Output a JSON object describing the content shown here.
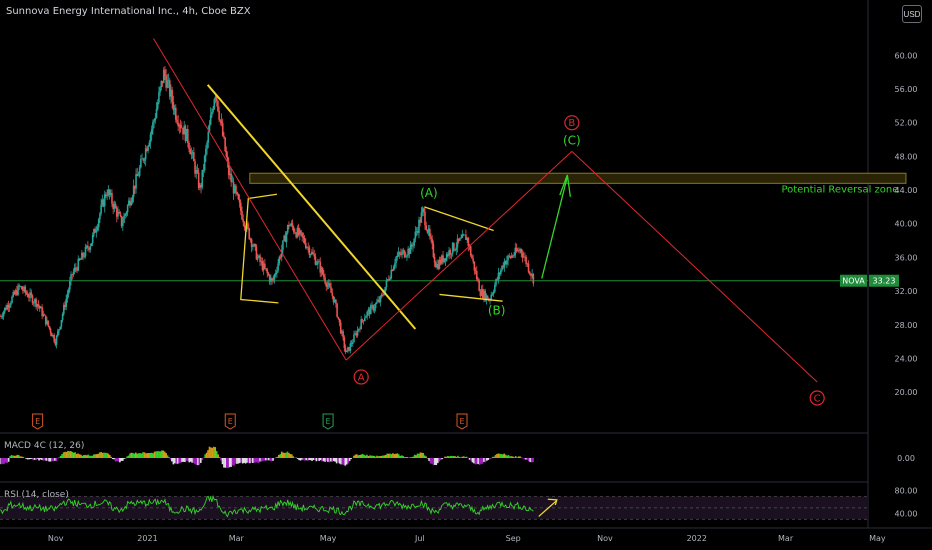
{
  "header": {
    "title": "Sunnova Energy International Inc., 4h, Cboe BZX"
  },
  "currency_button": "USD",
  "colors": {
    "bull": "#26a69a",
    "bear": "#ef5350",
    "yellow": "#f0d52a",
    "red": "#e0282d",
    "green": "#35d42a",
    "price_line": "#1e8c3a",
    "zone_fill": "#2a2306",
    "zone_border": "#8a7a20"
  },
  "chart_data": {
    "type": "candlestick",
    "title": "Sunnova Energy International Inc., 4h, Cboe BZX",
    "y_axis": {
      "ticks": [
        20.0,
        24.0,
        28.0,
        32.0,
        36.0,
        40.0,
        44.0,
        48.0,
        52.0,
        56.0,
        60.0
      ],
      "labels": [
        "20.00",
        "24.00",
        "28.00",
        "32.00",
        "36.00",
        "40.00",
        "44.00",
        "48.00",
        "52.00",
        "56.00",
        "60.00"
      ],
      "ylim": [
        15.5,
        64.2
      ]
    },
    "x_axis": {
      "labels": [
        "Nov",
        "2021",
        "Mar",
        "May",
        "Jul",
        "Sep",
        "Nov",
        "2022",
        "Mar",
        "May"
      ],
      "range": [
        "2020-09-25",
        "2022-05-28"
      ]
    },
    "last_price": {
      "ticker": "NOVA",
      "value": "33.23"
    },
    "price_path": [
      {
        "date": "2020-09-25",
        "price": 29.0
      },
      {
        "date": "2020-10-08",
        "price": 32.5
      },
      {
        "date": "2020-10-20",
        "price": 30.5
      },
      {
        "date": "2020-11-01",
        "price": 26.0
      },
      {
        "date": "2020-11-12",
        "price": 34.0
      },
      {
        "date": "2020-11-25",
        "price": 38.0
      },
      {
        "date": "2020-12-05",
        "price": 44.0
      },
      {
        "date": "2020-12-15",
        "price": 40.0
      },
      {
        "date": "2020-12-26",
        "price": 46.0
      },
      {
        "date": "2021-01-05",
        "price": 52.0
      },
      {
        "date": "2021-01-12",
        "price": 58.0
      },
      {
        "date": "2021-01-20",
        "price": 53.0
      },
      {
        "date": "2021-01-28",
        "price": 50.0
      },
      {
        "date": "2021-02-05",
        "price": 44.0
      },
      {
        "date": "2021-02-15",
        "price": 56.0
      },
      {
        "date": "2021-02-24",
        "price": 46.0
      },
      {
        "date": "2021-03-05",
        "price": 41.0
      },
      {
        "date": "2021-03-15",
        "price": 36.0
      },
      {
        "date": "2021-03-25",
        "price": 33.0
      },
      {
        "date": "2021-04-05",
        "price": 40.0
      },
      {
        "date": "2021-04-15",
        "price": 38.0
      },
      {
        "date": "2021-04-25",
        "price": 35.0
      },
      {
        "date": "2021-05-05",
        "price": 31.0
      },
      {
        "date": "2021-05-13",
        "price": 24.5
      },
      {
        "date": "2021-05-25",
        "price": 29.0
      },
      {
        "date": "2021-06-05",
        "price": 31.0
      },
      {
        "date": "2021-06-15",
        "price": 36.0
      },
      {
        "date": "2021-06-25",
        "price": 37.0
      },
      {
        "date": "2021-07-03",
        "price": 41.5
      },
      {
        "date": "2021-07-12",
        "price": 35.0
      },
      {
        "date": "2021-07-22",
        "price": 37.0
      },
      {
        "date": "2021-08-01",
        "price": 38.5
      },
      {
        "date": "2021-08-10",
        "price": 32.0
      },
      {
        "date": "2021-08-16",
        "price": 31.0
      },
      {
        "date": "2021-08-26",
        "price": 35.5
      },
      {
        "date": "2021-09-06",
        "price": 37.0
      },
      {
        "date": "2021-09-15",
        "price": 33.2
      }
    ],
    "horizontal_line": {
      "price": 33.23
    },
    "zone": {
      "label": "Potential Reversal zone",
      "from_price": 44.8,
      "to_price": 46.0,
      "from_date": "2021-03-10",
      "to_date": "2022-05-20"
    },
    "annotations": {
      "red_circles": [
        {
          "text": "B",
          "date": "2021-10-10",
          "price": 52.0
        },
        {
          "text": "A",
          "date": "2021-05-23",
          "price": 21.8
        },
        {
          "text": "C",
          "date": "2022-03-22",
          "price": 19.3
        }
      ],
      "green_labels": [
        {
          "text": "(A)",
          "date": "2021-07-07",
          "price": 43.2
        },
        {
          "text": "(C)",
          "date": "2021-10-10",
          "price": 49.4
        },
        {
          "text": "(B)",
          "date": "2021-08-21",
          "price": 29.2
        }
      ],
      "earnings_markers": [
        {
          "text": "E",
          "date": "2020-10-20",
          "color": "red"
        },
        {
          "text": "E",
          "date": "2021-02-25",
          "color": "red"
        },
        {
          "text": "E",
          "date": "2021-05-01",
          "color": "green"
        },
        {
          "text": "E",
          "date": "2021-07-29",
          "color": "red"
        }
      ]
    },
    "indicators": {
      "macd": {
        "label": "MACD 4C (12, 26)",
        "axis_ticks": [
          "0.00"
        ]
      },
      "rsi": {
        "label": "RSI (14, close)",
        "axis_ticks": [
          "80.00",
          "40.00"
        ],
        "levels": [
          70,
          50,
          30
        ]
      }
    }
  }
}
